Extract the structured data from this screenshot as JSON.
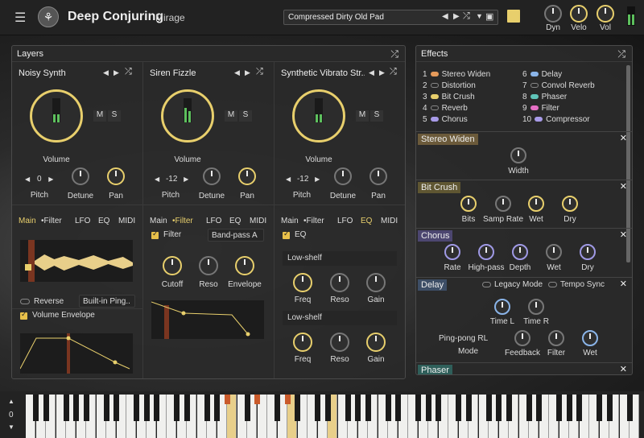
{
  "header": {
    "title": "Deep Conjuring",
    "subtitle": "Mirage",
    "preset": "Compressed Dirty Old Pad",
    "knobs": [
      {
        "label": "Dyn"
      },
      {
        "label": "Velo"
      },
      {
        "label": "Vol"
      }
    ]
  },
  "layers": {
    "title": "Layers",
    "columns": [
      {
        "name": "Noisy Synth",
        "m": "M",
        "s": "S",
        "volume": "Volume",
        "pitch_value": "0",
        "pitch": "Pitch",
        "detune": "Detune",
        "pan": "Pan"
      },
      {
        "name": "Siren Fizzle",
        "m": "M",
        "s": "S",
        "volume": "Volume",
        "pitch_value": "-12",
        "pitch": "Pitch",
        "detune": "Detune",
        "pan": "Pan"
      },
      {
        "name": "Synthetic Vibrato Str..",
        "m": "M",
        "s": "S",
        "volume": "Volume",
        "pitch_value": "-12",
        "pitch": "Pitch",
        "detune": "Detune",
        "pan": "Pan"
      }
    ],
    "tabs": [
      "Main",
      "•Filter",
      "LFO",
      "EQ",
      "MIDI"
    ],
    "col1": {
      "reverse": "Reverse",
      "sample": "Built-in Ping..",
      "env": "Volume Envelope"
    },
    "col2": {
      "filter": "Filter",
      "type": "Band-pass A",
      "cutoff": "Cutoff",
      "reso": "Reso",
      "envelope": "Envelope"
    },
    "col3": {
      "eq": "EQ",
      "band1": "Low-shelf",
      "band2": "Low-shelf",
      "freq": "Freq",
      "reso": "Reso",
      "gain": "Gain"
    }
  },
  "effects": {
    "title": "Effects",
    "list": [
      {
        "n": "1",
        "name": "Stereo Widen",
        "color": "#e59a5a"
      },
      {
        "n": "2",
        "name": "Distortion",
        "color": "#555"
      },
      {
        "n": "3",
        "name": "Bit Crush",
        "color": "#e8cf6c"
      },
      {
        "n": "4",
        "name": "Reverb",
        "color": "#555"
      },
      {
        "n": "5",
        "name": "Chorus",
        "color": "#a89be8"
      },
      {
        "n": "6",
        "name": "Delay",
        "color": "#8ab4e8"
      },
      {
        "n": "7",
        "name": "Convol Reverb",
        "color": "#555"
      },
      {
        "n": "8",
        "name": "Phaser",
        "color": "#5fc4b8"
      },
      {
        "n": "9",
        "name": "Filter",
        "color": "#e56fc4"
      },
      {
        "n": "10",
        "name": "Compressor",
        "color": "#a89be8"
      }
    ],
    "stereo_widen": {
      "title": "Stereo Widen",
      "width": "Width"
    },
    "bit_crush": {
      "title": "Bit Crush",
      "bits": "Bits",
      "samp_rate": "Samp Rate",
      "wet": "Wet",
      "dry": "Dry"
    },
    "chorus": {
      "title": "Chorus",
      "rate": "Rate",
      "high_pass": "High-pass",
      "depth": "Depth",
      "wet": "Wet",
      "dry": "Dry"
    },
    "delay": {
      "title": "Delay",
      "legacy": "Legacy Mode",
      "tempo": "Tempo Sync",
      "time_l": "Time L",
      "time_r": "Time R",
      "mode_value": "Ping-pong RL",
      "mode": "Mode",
      "feedback": "Feedback",
      "filter": "Filter",
      "wet": "Wet"
    },
    "phaser": {
      "title": "Phaser"
    }
  },
  "keyboard": {
    "octave": "0"
  }
}
